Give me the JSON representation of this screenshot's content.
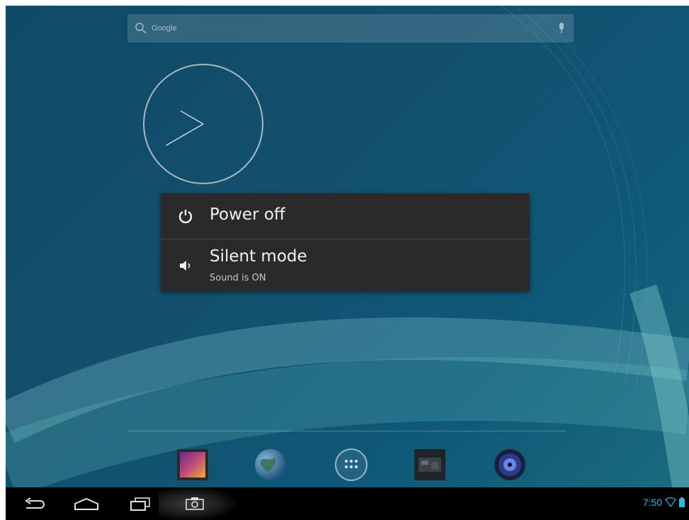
{
  "search": {
    "hint": "Google"
  },
  "clock": {
    "hour_hand_deg": 300,
    "minute_hand_deg": 240
  },
  "power_menu": {
    "items": [
      {
        "label": "Power off",
        "icon": "power-icon"
      },
      {
        "label": "Silent mode",
        "sublabel": "Sound is ON",
        "icon": "speaker-icon"
      }
    ]
  },
  "dock": {
    "apps": [
      {
        "name": "gallery-app-icon"
      },
      {
        "name": "browser-globe-app-icon"
      },
      {
        "name": "all-apps-icon"
      },
      {
        "name": "camera-app-icon"
      },
      {
        "name": "music-app-icon"
      }
    ]
  },
  "navigation": {
    "buttons": [
      "back-icon",
      "home-icon",
      "recent-apps-icon",
      "screenshot-icon"
    ]
  },
  "status_bar": {
    "time": "7:50",
    "accent_color": "#33b5e5",
    "icons": [
      "wifi-icon",
      "battery-icon"
    ]
  }
}
